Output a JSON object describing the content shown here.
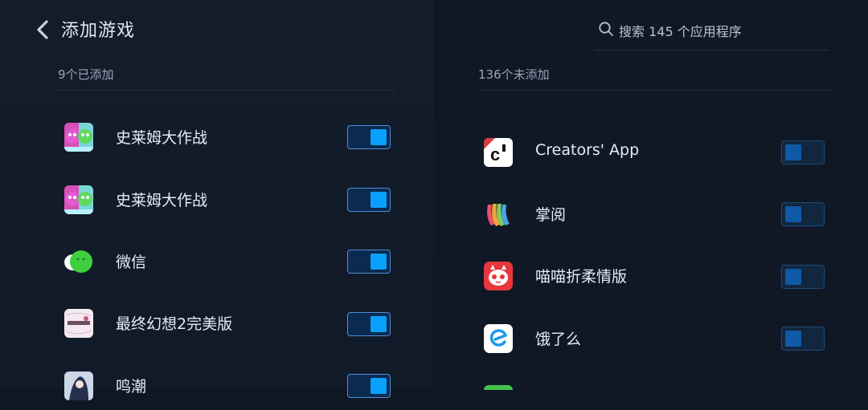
{
  "header": {
    "title": "添加游戏",
    "search_placeholder": "搜索 145 个应用程序"
  },
  "left": {
    "heading": "9个已添加",
    "apps": [
      {
        "name": "史莱姆大作战",
        "icon": "slime-battle-icon",
        "enabled": true
      },
      {
        "name": "史莱姆大作战",
        "icon": "slime-battle-icon",
        "enabled": true
      },
      {
        "name": "微信",
        "icon": "wechat-icon",
        "enabled": true
      },
      {
        "name": "最终幻想2完美版",
        "icon": "final-fantasy-icon",
        "enabled": true
      },
      {
        "name": "鸣潮",
        "icon": "wuthering-waves-icon",
        "enabled": true
      }
    ]
  },
  "right": {
    "heading": "136个未添加",
    "apps": [
      {
        "name": "Creators' App",
        "icon": "creators-app-icon",
        "enabled": false
      },
      {
        "name": "掌阅",
        "icon": "zhangyue-icon",
        "enabled": false
      },
      {
        "name": "喵喵折柔情版",
        "icon": "miaomiao-icon",
        "enabled": false
      },
      {
        "name": "饿了么",
        "icon": "eleme-icon",
        "enabled": false
      }
    ]
  },
  "colors": {
    "background": "#0f1724",
    "toggle_on": "#0aa0ff",
    "toggle_off": "#0f5aa6",
    "text": "#e7ecf4",
    "muted": "#9aa6b7"
  }
}
